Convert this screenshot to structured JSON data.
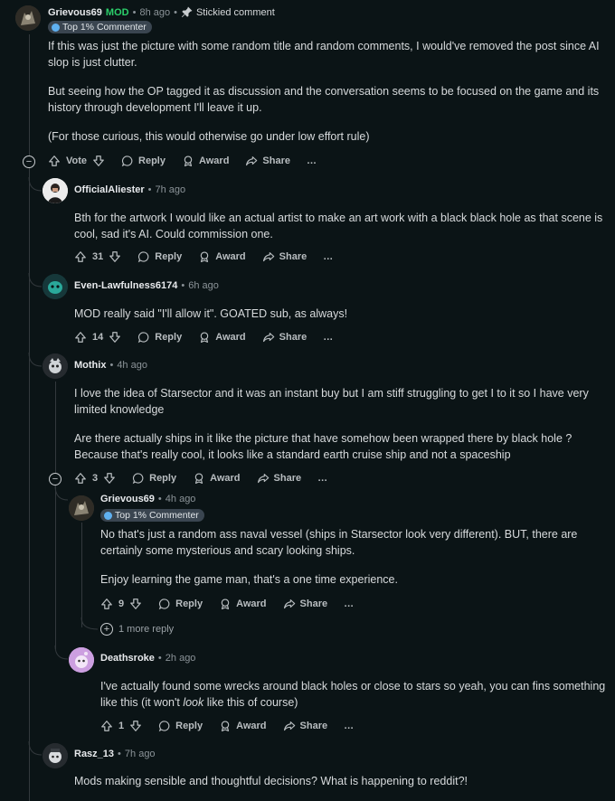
{
  "comments": [
    {
      "author": "Grievous69",
      "mod_badge": "MOD",
      "time": "8h ago",
      "sticky": "Stickied comment",
      "flair": "Top 1% Commenter",
      "paragraphs": [
        "If this was just the picture with some random title and random comments, I would've removed the post since AI slop is just clutter.",
        "But seeing how the OP tagged it as discussion and the conversation seems to be focused on the game and its history through development I'll leave it up.",
        "(For those curious, this would otherwise go under low effort rule)"
      ],
      "vote": "Vote",
      "reply": "Reply",
      "award": "Award",
      "share": "Share",
      "more": "…"
    },
    {
      "author": "OfficialAliester",
      "time": "7h ago",
      "paragraphs": [
        "Bth for the artwork I would like an actual artist to make an art work with a black black hole as that scene is cool, sad it's AI. Could commission one."
      ],
      "vote": "31",
      "reply": "Reply",
      "award": "Award",
      "share": "Share",
      "more": "…"
    },
    {
      "author": "Even-Lawfulness6174",
      "time": "6h ago",
      "paragraphs": [
        "MOD really said \"I'll allow it\". GOATED sub, as always!"
      ],
      "vote": "14",
      "reply": "Reply",
      "award": "Award",
      "share": "Share",
      "more": "…"
    },
    {
      "author": "Mothix",
      "time": "4h ago",
      "paragraphs": [
        "I love the idea of Starsector and it was an instant buy but I am stiff struggling to get I to it so I have very limited knowledge",
        "Are there actually ships in it like the picture that have somehow been wrapped there by black hole ? Because that's really cool, it looks like a standard earth cruise ship and not a spaceship"
      ],
      "vote": "3",
      "reply": "Reply",
      "award": "Award",
      "share": "Share",
      "more": "…"
    },
    {
      "author": "Grievous69",
      "time": "4h ago",
      "flair": "Top 1% Commenter",
      "paragraphs": [
        "No that's just a random ass naval vessel (ships in Starsector look very different). BUT, there are certainly some mysterious and scary looking ships.",
        "Enjoy learning the game man, that's a one time experience."
      ],
      "vote": "9",
      "reply": "Reply",
      "award": "Award",
      "share": "Share",
      "more": "…",
      "more_replies": "1 more reply"
    },
    {
      "author": "Deathsroke",
      "time": "2h ago",
      "paragraph_parts": [
        "I've actually found some wrecks around black holes or close to stars so yeah, you can fins something like this (it won't ",
        "look",
        " like this of course)"
      ],
      "vote": "1",
      "reply": "Reply",
      "award": "Award",
      "share": "Share",
      "more": "…"
    },
    {
      "author": "Rasz_13",
      "time": "7h ago",
      "paragraphs": [
        "Mods making sensible and thoughtful decisions? What is happening to reddit?!"
      ]
    }
  ],
  "separator": "•",
  "colors": {
    "background": "#0b1416",
    "mod": "#2bcf6a",
    "flair_bg": "#3a4550",
    "thread_line": "#33393d"
  }
}
